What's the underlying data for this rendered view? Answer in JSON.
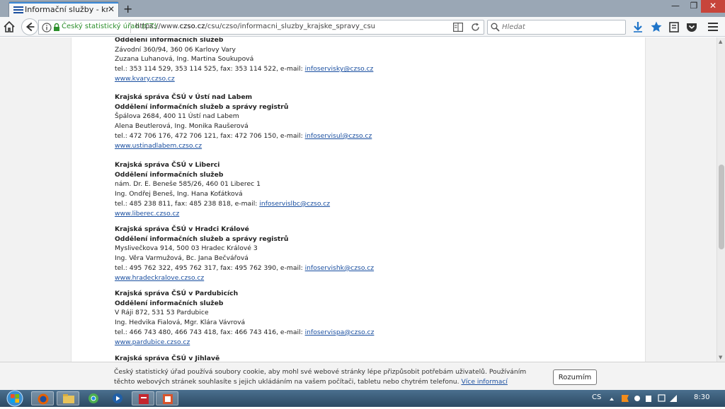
{
  "browser": {
    "tab_title": "Informační služby - krajské...",
    "tab_close": "✕",
    "new_tab": "+",
    "site_identity": "Český statistický úřad (CZ)",
    "url_prefix": "https://www.",
    "url_domain": "czso.cz",
    "url_path": "/csu/czso/informacni_sluzby_krajske_spravy_csu",
    "search_placeholder": "Hledat",
    "win_min": "—",
    "win_max": "❐",
    "win_close": "✕"
  },
  "entries": [
    {
      "dept": "Oddělení informačních služeb",
      "address": "Závodní 360/94, 360 06 Karlovy Vary",
      "people": "Zuzana Luhanová, Ing. Martina Soukupová",
      "contact": "tel.: 353 114 529, 353 114 525, fax: 353 114 522, e-mail: ",
      "email": "infoservisky@czso.cz",
      "web": "www.kvary.czso.cz"
    },
    {
      "name": "Krajská správa ČSÚ v Ústí nad Labem",
      "dept": "Oddělení informačních služeb a správy registrů",
      "address": "Špálova 2684, 400 11 Ústí nad Labem",
      "people": "Alena Beutlerová, Ing. Monika Raušerová",
      "contact": "tel.: 472 706 176, 472 706 121, fax: 472 706 150, e-mail: ",
      "email": "infoservisul@czso.cz",
      "web": "www.ustinadlabem.czso.cz"
    },
    {
      "name": "Krajská správa ČSÚ v Liberci",
      "dept": "Oddělení informačních služeb",
      "address": "nám. Dr. E. Beneše 585/26, 460 01 Liberec 1",
      "people": "Ing. Ondřej Beneš, Ing. Hana Koťátková",
      "contact": "tel.: 485 238 811, fax: 485 238 818, e-mail: ",
      "email": "infoservislbc@czso.cz",
      "web": "www.liberec.czso.cz"
    },
    {
      "name": "Krajská správa ČSÚ v Hradci Králové",
      "dept": "Oddělení informačních služeb a správy registrů",
      "address": "Myslivečkova 914, 500 03 Hradec Králové 3",
      "people": "Ing. Věra Varmužová, Bc. Jana Bečvářová",
      "contact": "tel.: 495 762 322, 495 762 317, fax: 495 762 390, e-mail: ",
      "email": "infoservishk@czso.cz",
      "web": "www.hradeckralove.czso.cz"
    },
    {
      "name": "Krajská správa ČSÚ v Pardubicích",
      "dept": "Oddělení informačních služeb",
      "address": "V Ráji 872, 531 53 Pardubice",
      "people": "Ing. Hedvika Fialová, Mgr. Klára Vávrová",
      "contact": "tel.: 466 743 480, 466 743 418, fax: 466 743 416, e-mail: ",
      "email": "infoservispa@czso.cz",
      "web": "www.pardubice.czso.cz"
    },
    {
      "name": "Krajská správa ČSÚ v Jihlavě"
    }
  ],
  "cookie": {
    "text": "Český statistický úřad používá soubory cookie, aby mohl své webové stránky lépe přizpůsobit potřebám uživatelů. Používáním těchto webových stránek souhlasíte s jejich ukládáním na vašem počítači, tabletu nebo chytrém telefonu.",
    "link": "Více informací",
    "button": "Rozumím"
  },
  "taskbar": {
    "language": "CS",
    "clock": "8:30"
  },
  "colors": {
    "link": "#1a4fa0",
    "identity_green": "#2c8f2c",
    "tab_accent": "#3b8ad9"
  }
}
